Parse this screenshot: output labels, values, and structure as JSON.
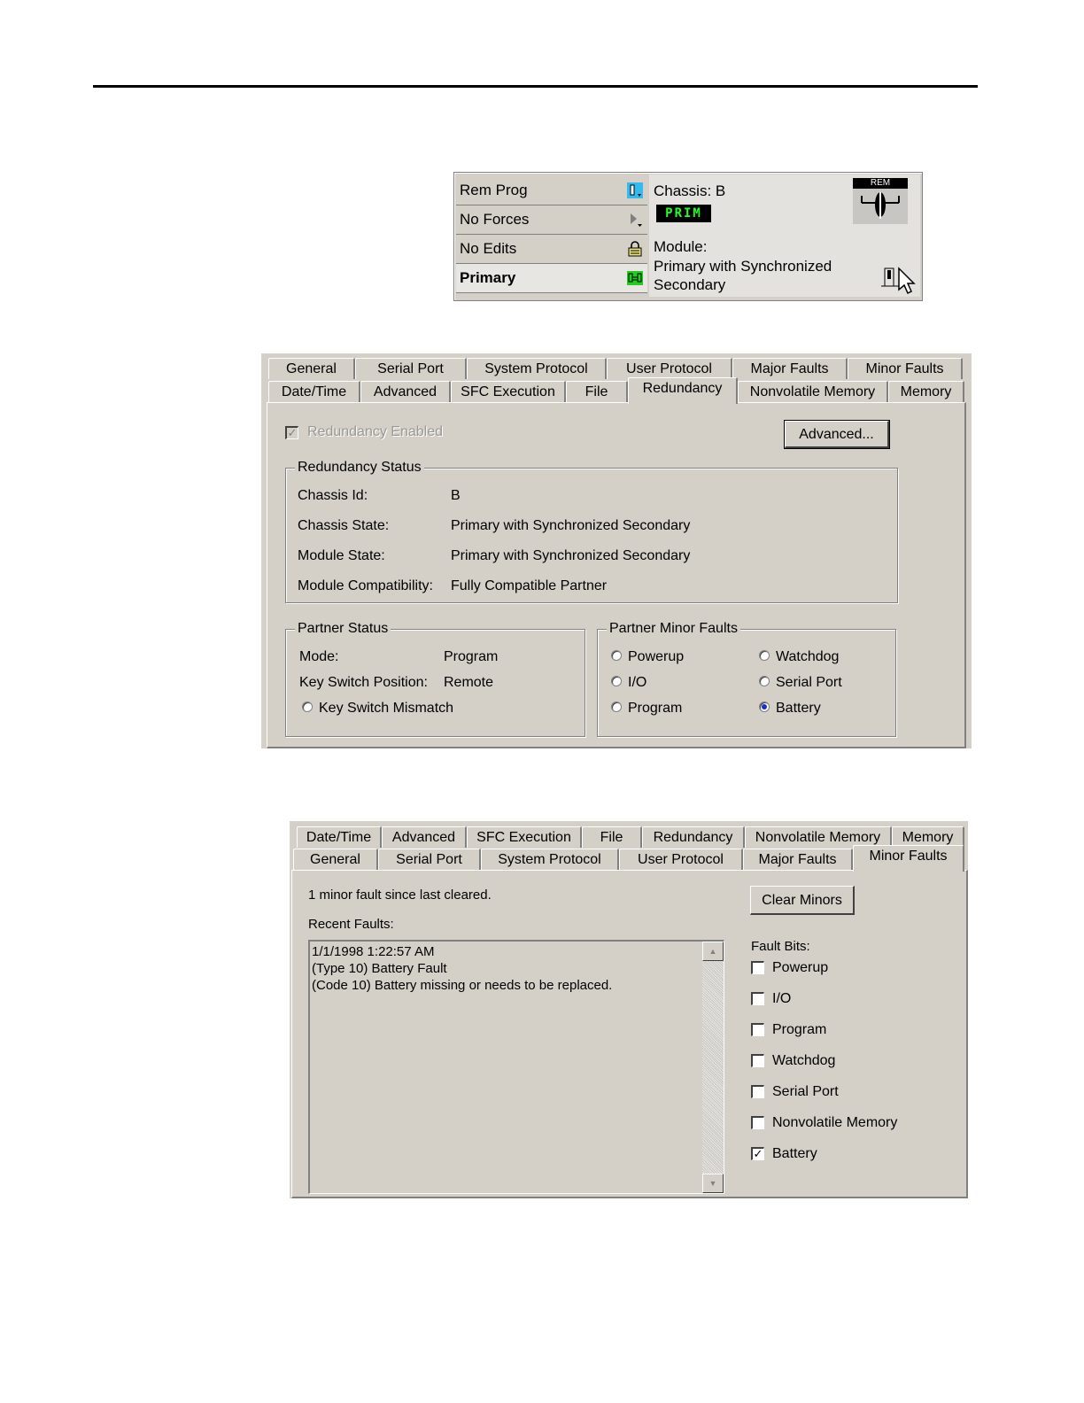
{
  "status_widget": {
    "rows": [
      {
        "label": "Rem Prog",
        "icon": "key-switch-icon"
      },
      {
        "label": "No Forces",
        "icon": "play-arrow-icon"
      },
      {
        "label": "No Edits",
        "icon": "padlock-icon"
      },
      {
        "label": "Primary",
        "icon": "redundancy-link-icon"
      }
    ],
    "chassis_label": "Chassis: B",
    "prim_badge": "PRIM",
    "rem_label": "REM",
    "module_label": "Module:",
    "module_state": "Primary with Synchronized Secondary",
    "colors": {
      "badge_bg": "#000000",
      "badge_text": "#22ff22",
      "primary_icon": "#22cc22",
      "key_icon": "#33bbee"
    }
  },
  "redundancy_dialog": {
    "tabs_back": [
      "General",
      "Serial Port",
      "System Protocol",
      "User Protocol",
      "Major Faults",
      "Minor Faults"
    ],
    "tabs_front": [
      "Date/Time",
      "Advanced",
      "SFC Execution",
      "File",
      "Redundancy",
      "Nonvolatile Memory",
      "Memory"
    ],
    "active_tab": "Redundancy",
    "redundancy_enabled_label": "Redundancy Enabled",
    "redundancy_enabled_checked": true,
    "advanced_button": "Advanced...",
    "status_group": {
      "title": "Redundancy Status",
      "rows": [
        {
          "label": "Chassis Id:",
          "value": "B"
        },
        {
          "label": "Chassis State:",
          "value": "Primary with Synchronized Secondary"
        },
        {
          "label": "Module State:",
          "value": "Primary with Synchronized Secondary"
        },
        {
          "label": "Module Compatibility:",
          "value": "Fully Compatible Partner"
        }
      ]
    },
    "partner_status": {
      "title": "Partner Status",
      "mode_label": "Mode:",
      "mode_value": "Program",
      "key_label": "Key Switch Position:",
      "key_value": "Remote",
      "mismatch_label": "Key Switch Mismatch"
    },
    "partner_minor_faults": {
      "title": "Partner Minor Faults",
      "items": [
        {
          "label": "Powerup",
          "on": false
        },
        {
          "label": "Watchdog",
          "on": false
        },
        {
          "label": "I/O",
          "on": false
        },
        {
          "label": "Serial Port",
          "on": false
        },
        {
          "label": "Program",
          "on": false
        },
        {
          "label": "Battery",
          "on": true
        }
      ]
    }
  },
  "minor_faults_dialog": {
    "tabs_back": [
      "Date/Time",
      "Advanced",
      "SFC Execution",
      "File",
      "Redundancy",
      "Nonvolatile Memory",
      "Memory"
    ],
    "tabs_front": [
      "General",
      "Serial Port",
      "System Protocol",
      "User Protocol",
      "Major Faults",
      "Minor Faults"
    ],
    "active_tab": "Minor Faults",
    "summary": "1 minor fault since last cleared.",
    "recent_faults_label": "Recent Faults:",
    "recent_faults_text": "1/1/1998 1:22:57 AM\n(Type 10) Battery Fault\n(Code 10) Battery missing or needs to be replaced.",
    "clear_button": "Clear Minors",
    "fault_bits_label": "Fault Bits:",
    "fault_bits": [
      {
        "label": "Powerup",
        "checked": false
      },
      {
        "label": "I/O",
        "checked": false
      },
      {
        "label": "Program",
        "checked": false
      },
      {
        "label": "Watchdog",
        "checked": false
      },
      {
        "label": "Serial Port",
        "checked": false
      },
      {
        "label": "Nonvolatile Memory",
        "checked": false
      },
      {
        "label": "Battery",
        "checked": true
      }
    ]
  }
}
